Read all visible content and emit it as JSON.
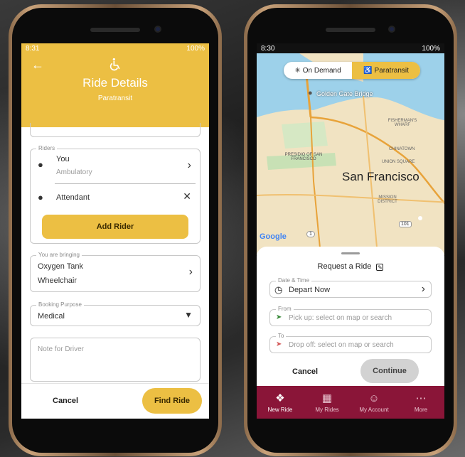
{
  "colors": {
    "brand_yellow": "#ecbf43",
    "brand_maroon": "#8a1538",
    "map_land": "#f1e3c2",
    "map_water": "#9dd1ea",
    "map_park": "#c8e1b5"
  },
  "left": {
    "status": {
      "time": "8:31",
      "battery": "100%"
    },
    "header": {
      "title": "Ride Details",
      "subtitle": "Paratransit",
      "back_icon": "arrow-left-icon",
      "wheelchair_icon": "wheelchair-icon"
    },
    "riders": {
      "legend": "Riders",
      "items": [
        {
          "name": "You",
          "type": "Ambulatory"
        },
        {
          "name": "Attendant"
        }
      ],
      "add_label": "Add Rider"
    },
    "bringing": {
      "legend": "You are bringing",
      "items": [
        "Oxygen Tank",
        "Wheelchair"
      ]
    },
    "purpose": {
      "legend": "Booking Purpose",
      "value": "Medical"
    },
    "note": {
      "placeholder": "Note for Driver"
    },
    "footer": {
      "cancel": "Cancel",
      "find": "Find Ride"
    }
  },
  "right": {
    "status": {
      "time": "8:30",
      "battery": "100%"
    },
    "toggle": {
      "on_demand": "On Demand",
      "paratransit": "Paratransit"
    },
    "map": {
      "city": "San Francisco",
      "labels": [
        "Golden Gate Bridge",
        "FISHERMAN'S WHARF",
        "PRESIDIO OF SAN FRANCISCO",
        "CHINATOWN",
        "UNION SQUARE",
        "MISSION DISTRICT"
      ],
      "google": "Google",
      "route_1": "1",
      "route_101": "101"
    },
    "sheet": {
      "title": "Request a Ride",
      "datetime_legend": "Date & Time",
      "datetime_value": "Depart Now",
      "from_legend": "From",
      "from_placeholder": "Pick up: select on map or search",
      "to_legend": "To",
      "to_placeholder": "Drop off: select on map or search",
      "cancel": "Cancel",
      "continue": "Continue"
    },
    "nav": [
      {
        "label": "New Ride",
        "icon": "route-icon"
      },
      {
        "label": "My Rides",
        "icon": "calendar-car-icon"
      },
      {
        "label": "My Account",
        "icon": "user-icon"
      },
      {
        "label": "More",
        "icon": "more-icon"
      }
    ]
  }
}
